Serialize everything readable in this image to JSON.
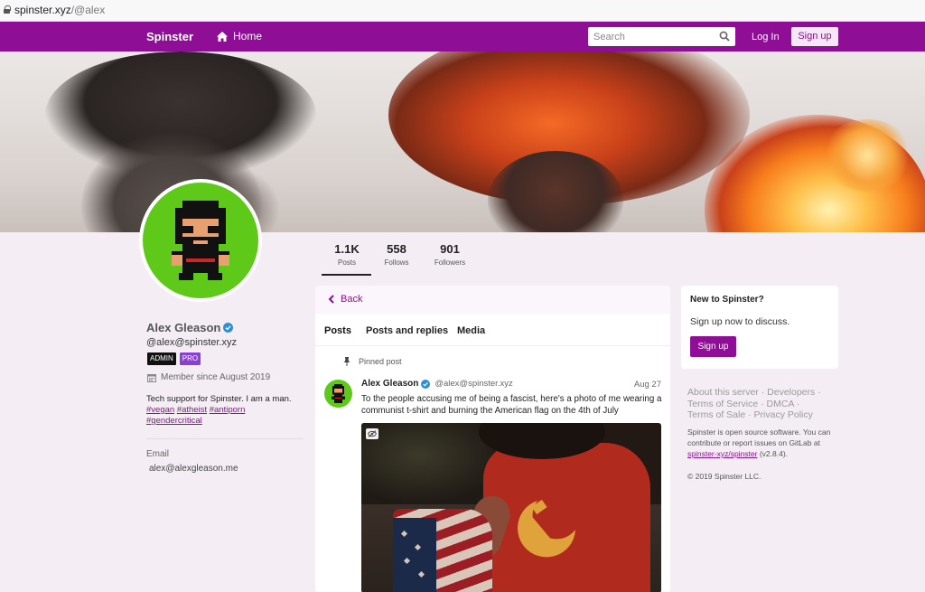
{
  "browser": {
    "url_host": "spinster.xyz",
    "url_path": "/@alex"
  },
  "nav": {
    "brand": "Spinster",
    "home_label": "Home",
    "search_placeholder": "Search",
    "login_label": "Log In",
    "signup_label": "Sign up",
    "accent": "#8e0e96"
  },
  "stats": [
    {
      "value": "1.1K",
      "label": "Posts"
    },
    {
      "value": "558",
      "label": "Follows"
    },
    {
      "value": "901",
      "label": "Followers"
    }
  ],
  "profile": {
    "display_name": "Alex Gleason",
    "handle": "@alex@spinster.xyz",
    "badges": [
      "ADMIN",
      "PRO"
    ],
    "member_since": "Member since August 2019",
    "bio_text": "Tech support for Spinster. I am a man.",
    "bio_tags": [
      "#vegan",
      "#atheist",
      "#antiporn",
      "#gendercritical"
    ],
    "email_label": "Email",
    "email_value": "alex@alexgleason.me"
  },
  "timeline": {
    "back_label": "Back",
    "tabs": [
      "Posts",
      "Posts and replies",
      "Media"
    ],
    "pinned_label": "Pinned post",
    "post": {
      "author": "Alex Gleason",
      "acct": "@alex@spinster.xyz",
      "date": "Aug 27",
      "text": "To the people accusing me of being a fascist, here's a photo of me wearing a communist t-shirt and burning the American flag on the 4th of July"
    }
  },
  "sidebar": {
    "signup_title": "New to Spinster?",
    "signup_text": "Sign up now to discuss.",
    "signup_button": "Sign up",
    "footer_links": [
      "About this server",
      "Developers",
      "Terms of Service",
      "DMCA",
      "Terms of Sale",
      "Privacy Policy"
    ],
    "footer_about_1": "Spinster is open source software. You can contribute or report issues on GitLab at",
    "footer_repo": "spinster-xyz/spinster",
    "footer_version": "(v2.8.4).",
    "footer_copyright": "© 2019 Spinster LLC."
  }
}
